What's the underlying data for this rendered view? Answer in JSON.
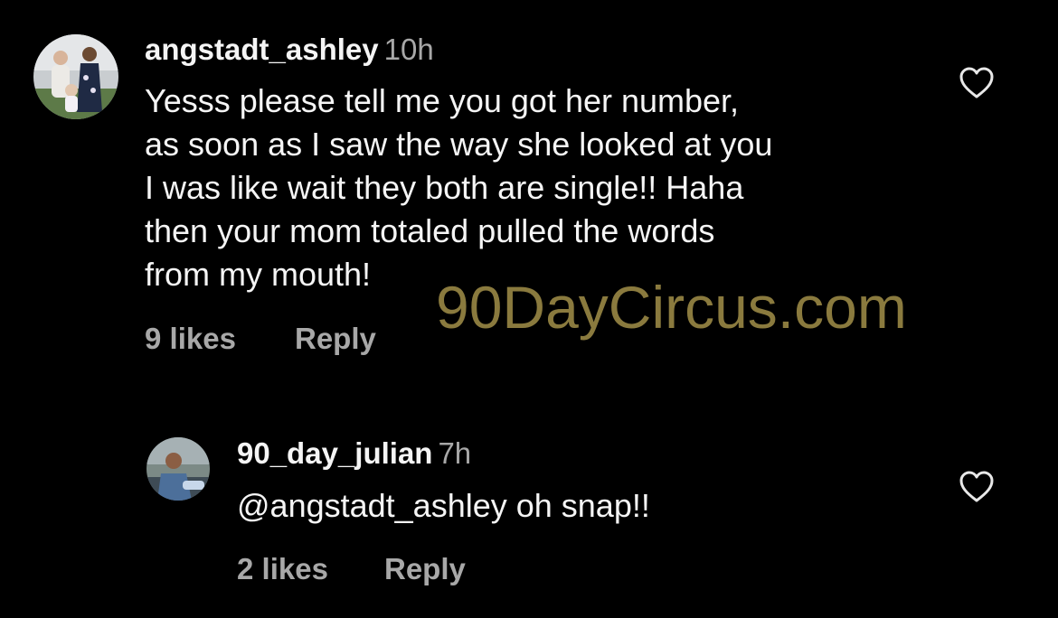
{
  "comments": [
    {
      "username": "angstadt_ashley",
      "time": "10h",
      "text_lines": [
        "Yesss please tell me you got her number,",
        "as soon as I saw the way she looked at you",
        "I was like wait they both are single!! Haha",
        "then your mom totaled pulled the words",
        "from my mouth!"
      ],
      "likes": "9 likes",
      "reply": "Reply",
      "like_icon": "heart-outline-icon"
    },
    {
      "username": "90_day_julian",
      "time": "7h",
      "text_lines": [
        "@angstadt_ashley oh snap!!"
      ],
      "likes": "2 likes",
      "reply": "Reply",
      "like_icon": "heart-outline-icon"
    }
  ],
  "watermark": "90DayCircus.com",
  "colors": {
    "background": "#000000",
    "primary_text": "#f5f5f5",
    "secondary_text": "#a8a8a8",
    "watermark": "#8a7a3e"
  }
}
